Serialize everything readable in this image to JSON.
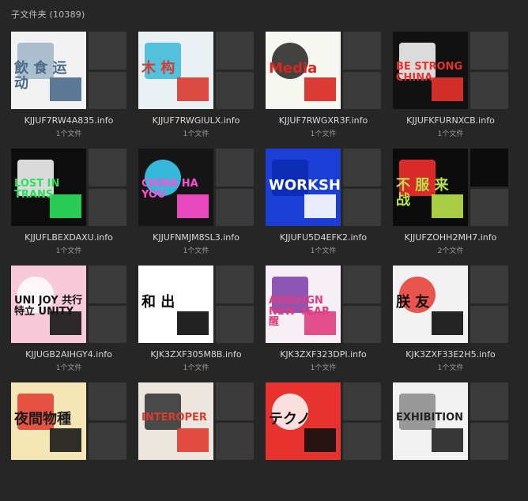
{
  "header": {
    "title": "子文件夹 (10389)"
  },
  "folders": [
    {
      "name": "KJJUF7RW4A835.info",
      "count": "1个文件",
      "poster": {
        "bg": "#f2f2f2",
        "fg": "#4a6b8a",
        "accent": "#9fb6c8",
        "text": "飲 食 运 动"
      }
    },
    {
      "name": "KJJUF7RWGIULX.info",
      "count": "1个文件",
      "poster": {
        "bg": "#e9f1f4",
        "fg": "#d83a2f",
        "accent": "#38b7d7",
        "text": "木 构"
      }
    },
    {
      "name": "KJJUF7RWGXR3F.info",
      "count": "1个文件",
      "poster": {
        "bg": "#f7f7f2",
        "fg": "#d8251f",
        "accent": "#222222",
        "text": "Media"
      }
    },
    {
      "name": "KJJUFKFURNXCB.info",
      "count": "1个文件",
      "poster": {
        "bg": "#111111",
        "fg": "#e8332c",
        "accent": "#ffffff",
        "text": "BE STRONG CHINA"
      }
    },
    {
      "name": "KJJUFLBEXDAXU.info",
      "count": "1个文件",
      "poster": {
        "bg": "#0d0d0d",
        "fg": "#2be15c",
        "accent": "#ffffff",
        "text": "LOST IN TRANS"
      }
    },
    {
      "name": "KJJUFNMJM8SL3.info",
      "count": "1个文件",
      "poster": {
        "bg": "#151515",
        "fg": "#ff4fd0",
        "accent": "#3cd3ff",
        "text": "CHINA HA YOU"
      }
    },
    {
      "name": "KJJUFU5D4EFK2.info",
      "count": "1个文件",
      "poster": {
        "bg": "#1b3fd6",
        "fg": "#ffffff",
        "accent": "#0a2ab0",
        "text": "WORKSHOP"
      }
    },
    {
      "name": "KJJUFZOHH2MH7.info",
      "count": "2个文件",
      "poster": {
        "bg": "#0b0b0b",
        "fg": "#b7e24a",
        "accent": "#ff2f2f",
        "text": "不 服 来 战"
      }
    },
    {
      "name": "KJJUGB2AIHGY4.info",
      "count": "1个文件",
      "poster": {
        "bg": "#f8c9d8",
        "fg": "#151515",
        "accent": "#ffffff",
        "text": "UNI JOY 共行特立 UNITY"
      }
    },
    {
      "name": "KJK3ZXF305M8B.info",
      "count": "1个文件",
      "poster": {
        "bg": "#ffffff",
        "fg": "#0a0a0a",
        "accent": "#ffffff",
        "text": "和 出"
      }
    },
    {
      "name": "KJK3ZXF323DPI.info",
      "count": "1个文件",
      "poster": {
        "bg": "#f6f0f6",
        "fg": "#e03c7d",
        "accent": "#7a3ba8",
        "text": "AMAZIGN NEW YEAR 醒"
      }
    },
    {
      "name": "KJK3ZXF33E2H5.info",
      "count": "1个文件",
      "poster": {
        "bg": "#f2f2f2",
        "fg": "#0d0d0d",
        "accent": "#e83a2f",
        "text": "朕 友"
      }
    },
    {
      "name": "",
      "count": "",
      "poster": {
        "bg": "#f5e6b6",
        "fg": "#1a1a1a",
        "accent": "#e4382f",
        "text": "夜間物種"
      }
    },
    {
      "name": "",
      "count": "",
      "poster": {
        "bg": "#ece6de",
        "fg": "#e03a2f",
        "accent": "#2d2d2d",
        "text": "INTEROPER"
      }
    },
    {
      "name": "",
      "count": "",
      "poster": {
        "bg": "#e8322d",
        "fg": "#111111",
        "accent": "#ffffff",
        "text": "テクノ"
      }
    },
    {
      "name": "",
      "count": "",
      "poster": {
        "bg": "#f2f2f2",
        "fg": "#222222",
        "accent": "#8a8a8a",
        "text": "EXHIBITION"
      }
    }
  ]
}
